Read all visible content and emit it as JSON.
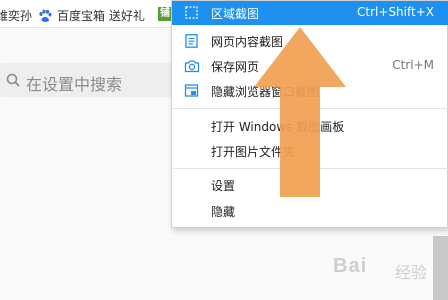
{
  "bookmarks": {
    "left_fragment": "维奕孙",
    "baidu_label": "百度宝箱 送好礼",
    "green_badge": "铺"
  },
  "settings": {
    "search_placeholder": "在设置中搜索"
  },
  "menu": {
    "items": [
      {
        "label": "区域截图",
        "shortcut": "Ctrl+Shift+X",
        "icon": "region-capture-icon",
        "highlighted": true
      },
      {
        "label": "网页内容截图",
        "icon": "webpage-content-icon"
      },
      {
        "label": "保存网页",
        "shortcut": "Ctrl+M",
        "icon": "camera-icon"
      },
      {
        "label": "隐藏浏览器窗口截图",
        "icon": "hide-window-icon"
      },
      {
        "label": "打开 Windows 截图画板"
      },
      {
        "label": "打开图片文件夹"
      },
      {
        "label": "设置"
      },
      {
        "label": "隐藏"
      }
    ]
  },
  "watermark": {
    "text": "Bai",
    "suffix": "经验"
  },
  "colors": {
    "highlight": "#1e90f0",
    "arrow": "#f0a050",
    "baidu_blue": "#2f6fe0",
    "green_badge": "#5a9e2f"
  }
}
